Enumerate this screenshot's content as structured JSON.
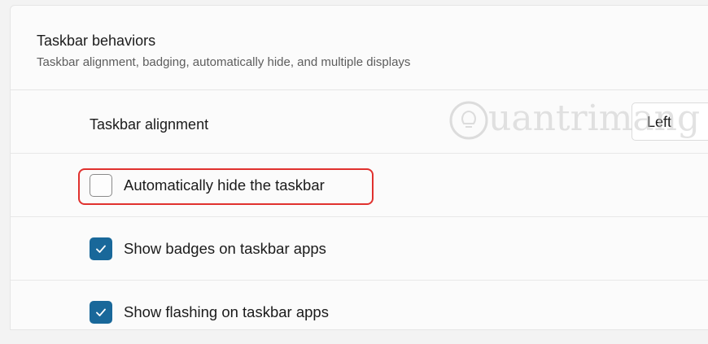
{
  "header": {
    "title": "Taskbar behaviors",
    "subtitle": "Taskbar alignment, badging, automatically hide, and multiple displays"
  },
  "alignment": {
    "label": "Taskbar alignment",
    "value": "Left"
  },
  "checkboxes": [
    {
      "label": "Automatically hide the taskbar",
      "checked": false,
      "highlighted": true
    },
    {
      "label": "Show badges on taskbar apps",
      "checked": true
    },
    {
      "label": "Show flashing on taskbar apps",
      "checked": true
    }
  ],
  "watermark": {
    "text": "uantrimang",
    "icon": "lightbulb-icon"
  },
  "colors": {
    "accent": "#19689a",
    "highlight": "#e0312e",
    "panel": "#fbfbfb",
    "background": "#f3f3f3"
  }
}
